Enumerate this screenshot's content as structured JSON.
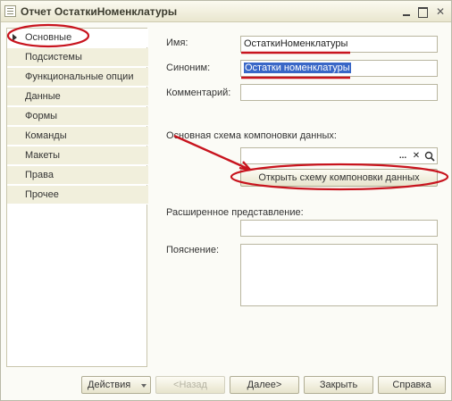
{
  "window": {
    "title": "Отчет ОстаткиНоменклатуры"
  },
  "nav": {
    "items": [
      {
        "label": "Основные",
        "active": true
      },
      {
        "label": "Подсистемы"
      },
      {
        "label": "Функциональные опции"
      },
      {
        "label": "Данные"
      },
      {
        "label": "Формы"
      },
      {
        "label": "Команды"
      },
      {
        "label": "Макеты"
      },
      {
        "label": "Права"
      },
      {
        "label": "Прочее"
      }
    ]
  },
  "form": {
    "name_label": "Имя:",
    "name_value": "ОстаткиНоменклатуры",
    "synonym_label": "Синоним:",
    "synonym_value": "Остатки номенклатуры",
    "comment_label": "Комментарий:",
    "comment_value": "",
    "schema_label": "Основная схема компоновки данных:",
    "schema_value": "",
    "schema_select": "...",
    "schema_clear": "✕",
    "schema_search": "🔍",
    "open_schema_button": "Открыть схему компоновки данных",
    "extended_label": "Расширенное представление:",
    "extended_value": "",
    "explanation_label": "Пояснение:",
    "explanation_value": ""
  },
  "footer": {
    "actions": "Действия",
    "back": "<Назад",
    "next": "Далее>",
    "close": "Закрыть",
    "help": "Справка"
  },
  "colors": {
    "annotation": "#c8141e",
    "selection": "#3967c7"
  }
}
